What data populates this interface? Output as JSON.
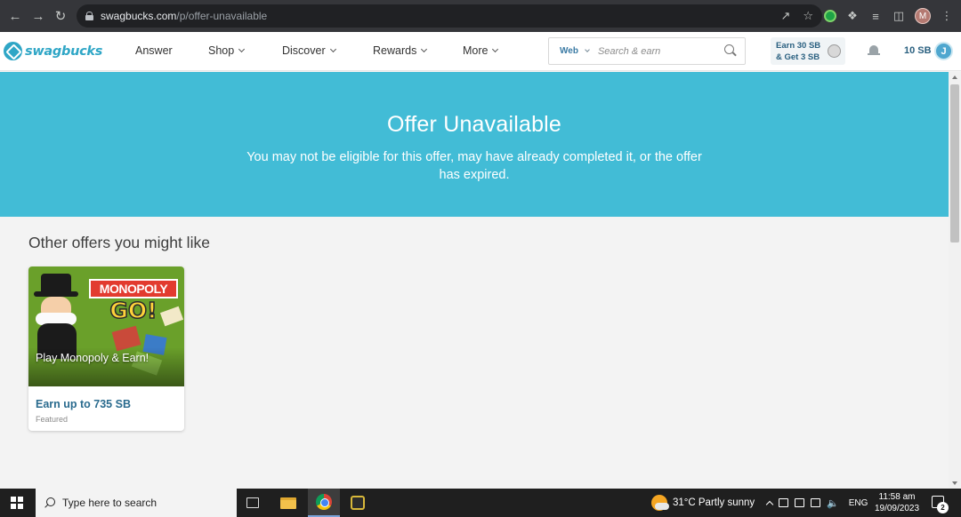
{
  "browser": {
    "url_host": "swagbucks.com",
    "url_path": "/p/offer-unavailable",
    "profile_initial": "M"
  },
  "header": {
    "logo_text": "swagbucks",
    "nav": {
      "answer": "Answer",
      "shop": "Shop",
      "discover": "Discover",
      "rewards": "Rewards",
      "more": "More"
    },
    "search": {
      "scope": "Web",
      "placeholder": "Search & earn"
    },
    "promo": {
      "line1": "Earn 30 SB",
      "line2": "& Get 3 SB"
    },
    "balance": "10 SB",
    "avatar_initial": "J"
  },
  "hero": {
    "title": "Offer Unavailable",
    "message": "You may not be eligible for this offer, may have already completed it, or the offer has expired."
  },
  "offers": {
    "section_title": "Other offers you might like",
    "items": [
      {
        "image_logo_top": "MONOPOLY",
        "image_logo_bottom": "GO!",
        "caption": "Play Monopoly & Earn!",
        "earn": "Earn up to 735 SB",
        "tag": "Featured"
      }
    ]
  },
  "taskbar": {
    "search_placeholder": "Type here to search",
    "weather": "31°C  Partly sunny",
    "language": "ENG",
    "time": "11:58 am",
    "date": "19/09/2023",
    "notification_count": "2"
  },
  "colors": {
    "brand": "#2fa6c6",
    "hero_bg": "#42bcd6",
    "link": "#2a6b8e"
  }
}
